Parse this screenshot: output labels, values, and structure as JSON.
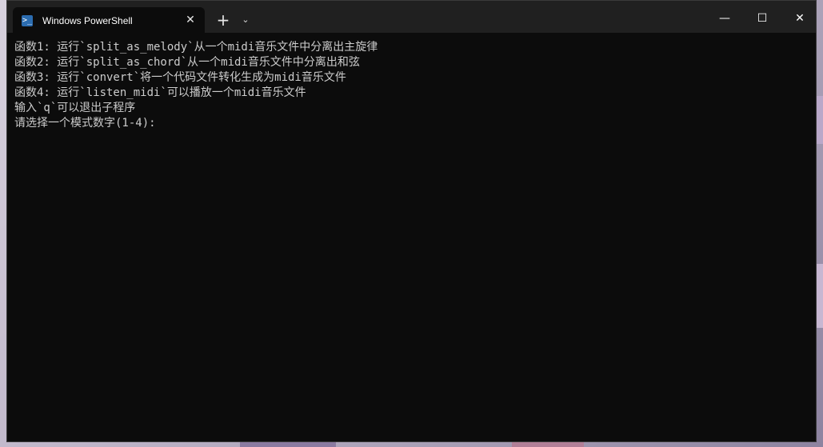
{
  "window": {
    "tab_title": "Windows PowerShell",
    "tab_icon": "powershell-icon",
    "new_tab_label": "+",
    "dropdown_label": "⌄",
    "minimize_label": "—",
    "maximize_label": "☐",
    "close_label": "✕"
  },
  "terminal": {
    "lines": [
      "函数1: 运行`split_as_melody`从一个midi音乐文件中分离出主旋律",
      "函数2: 运行`split_as_chord`从一个midi音乐文件中分离出和弦",
      "函数3: 运行`convert`将一个代码文件转化生成为midi音乐文件",
      "函数4: 运行`listen_midi`可以播放一个midi音乐文件",
      "输入`q`可以退出子程序",
      "请选择一个模式数字(1-4):"
    ]
  },
  "colors": {
    "terminal_bg": "#0c0c0c",
    "titlebar_bg": "#202020",
    "text": "#cccccc",
    "accent": "#2b6cb0"
  }
}
